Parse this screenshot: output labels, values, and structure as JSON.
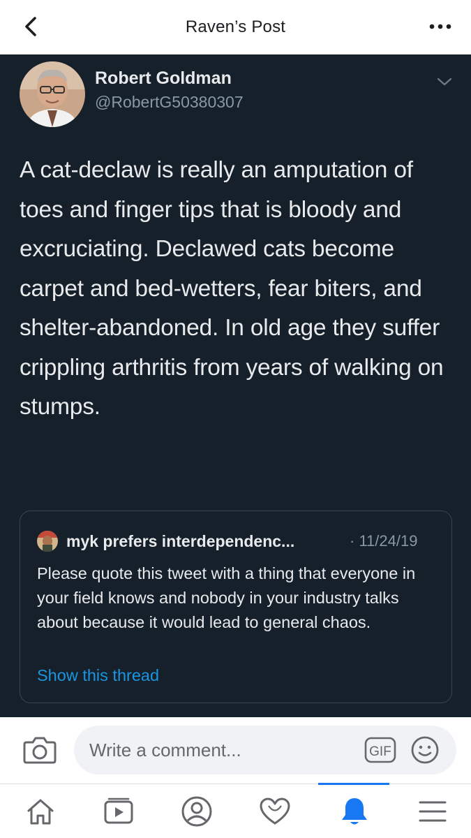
{
  "header": {
    "title": "Raven’s Post",
    "back_icon": "chevron-left-icon",
    "more_icon": "more-horizontal-icon"
  },
  "tweet": {
    "author_name": "Robert Goldman",
    "author_handle": "@RobertG50380307",
    "text": "A cat-declaw is really an amputation of toes and finger tips that is bloody and excruciating. Declawed cats become carpet and bed-wetters, fear biters, and shelter-abandoned. In old age they suffer crippling arthritis from years of walking on stumps.",
    "quoted": {
      "author_name": "myk prefers interdependenc...",
      "date": "· 11/24/19",
      "text": "Please quote this tweet with a thing that everyone in your field knows and nobody in your industry talks about because it would lead to general chaos.",
      "thread_link": "Show this thread"
    }
  },
  "comment": {
    "placeholder": "Write a comment...",
    "gif_label": "GIF"
  },
  "tabs": [
    {
      "name": "home",
      "icon": "home-icon"
    },
    {
      "name": "watch",
      "icon": "video-icon"
    },
    {
      "name": "profile",
      "icon": "profile-icon"
    },
    {
      "name": "dating",
      "icon": "heart-icon"
    },
    {
      "name": "notifications",
      "icon": "bell-icon",
      "active": true
    },
    {
      "name": "menu",
      "icon": "menu-icon"
    }
  ],
  "colors": {
    "tweet_background": "#15202b",
    "link_blue": "#1b95e0",
    "active_tab": "#1877f2",
    "icon_gray": "#65676b"
  }
}
